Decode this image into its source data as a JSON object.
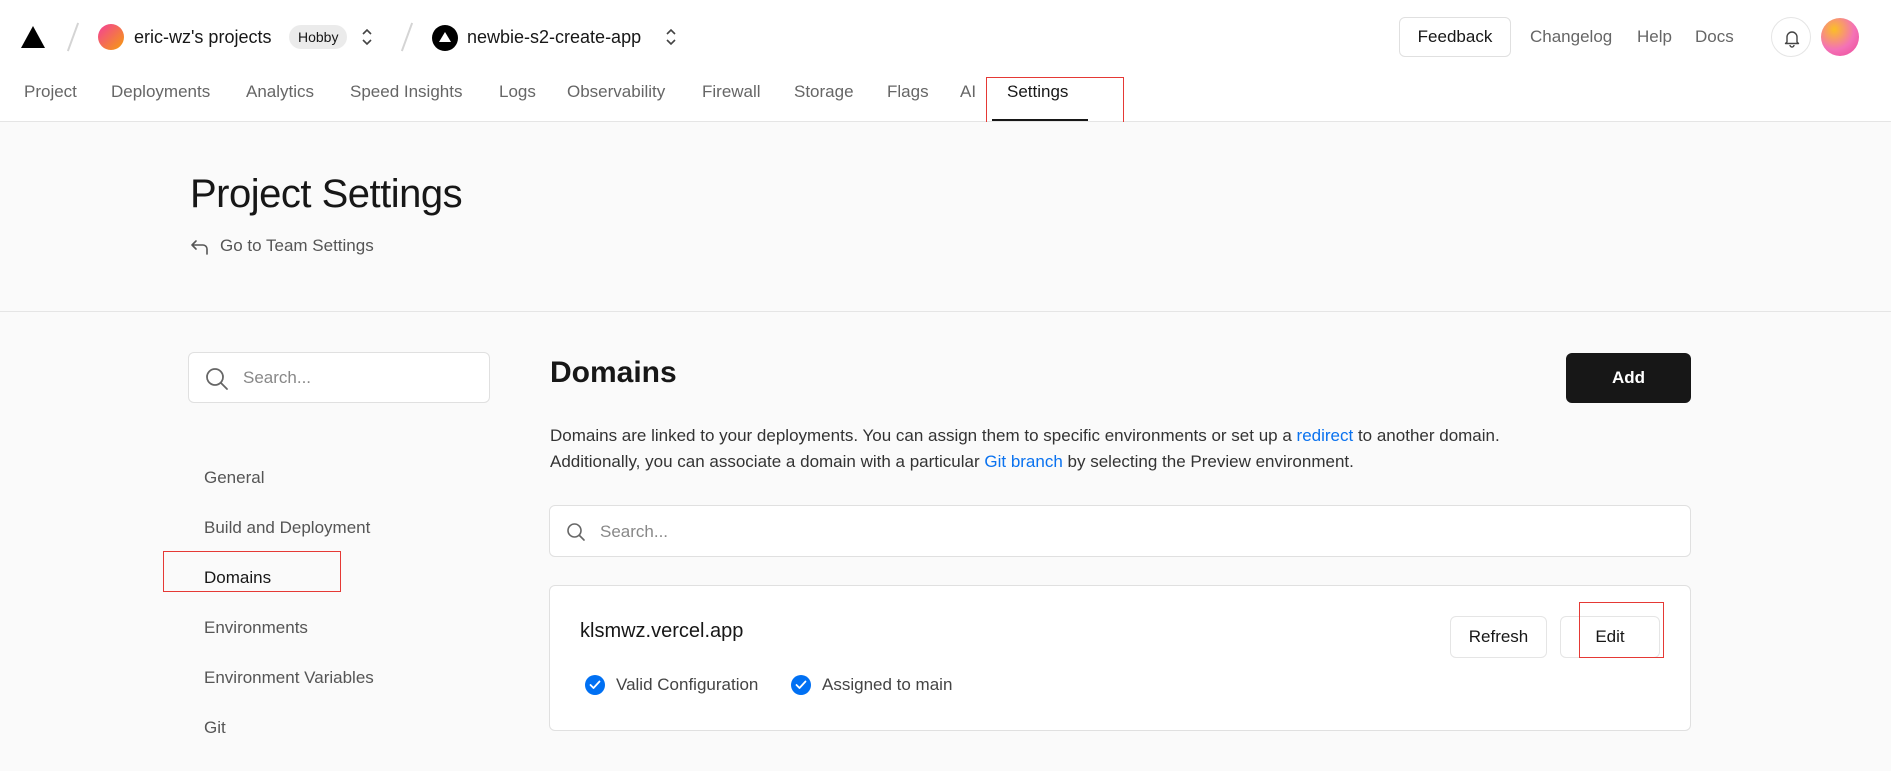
{
  "topbar": {
    "team_name": "eric-wz's projects",
    "team_plan": "Hobby",
    "project_name": "newbie-s2-create-app",
    "feedback_label": "Feedback",
    "links": [
      "Changelog",
      "Help",
      "Docs"
    ]
  },
  "tabs": [
    {
      "label": "Project"
    },
    {
      "label": "Deployments"
    },
    {
      "label": "Analytics"
    },
    {
      "label": "Speed Insights"
    },
    {
      "label": "Logs"
    },
    {
      "label": "Observability"
    },
    {
      "label": "Firewall"
    },
    {
      "label": "Storage"
    },
    {
      "label": "Flags"
    },
    {
      "label": "AI"
    },
    {
      "label": "Settings",
      "active": true
    }
  ],
  "page": {
    "title": "Project Settings",
    "back_link": "Go to Team Settings"
  },
  "sidebar": {
    "search_placeholder": "Search...",
    "items": [
      {
        "label": "General"
      },
      {
        "label": "Build and Deployment"
      },
      {
        "label": "Domains",
        "active": true
      },
      {
        "label": "Environments"
      },
      {
        "label": "Environment Variables"
      },
      {
        "label": "Git"
      }
    ]
  },
  "main": {
    "title": "Domains",
    "add_label": "Add",
    "desc_line1_a": "Domains are linked to your deployments. You can assign them to specific environments or set up a",
    "desc_line1_link": "redirect",
    "desc_line1_b": "to another domain.",
    "desc_line2_a": "Additionally, you can associate a domain with a particular",
    "desc_line2_link": "Git branch",
    "desc_line2_b": "by selecting the Preview environment.",
    "search_placeholder": "Search...",
    "domains": [
      {
        "name": "klsmwz.vercel.app",
        "refresh_label": "Refresh",
        "edit_label": "Edit",
        "statuses": [
          "Valid Configuration",
          "Assigned to main"
        ]
      }
    ]
  },
  "colors": {
    "accent_link": "#0a72ef",
    "status_check": "#0070f3",
    "primary_button": "#171717",
    "highlight_box": "#e53935"
  }
}
